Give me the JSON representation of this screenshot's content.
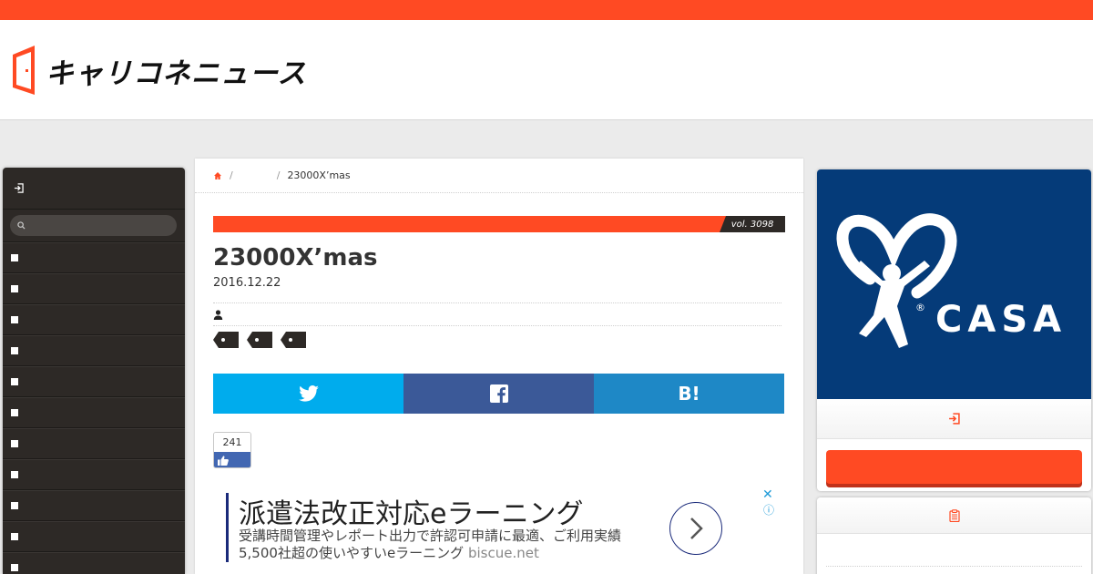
{
  "brand": {
    "logo_text": "キャリコネニュース",
    "accent_color": "#ff4a23"
  },
  "leftnav": {
    "login_icon": "login-icon",
    "search_icon": "search-icon",
    "search_placeholder": "",
    "item_count": 11
  },
  "breadcrumb": {
    "home_icon": "home-icon",
    "separator": "/",
    "current": "23000X’mas"
  },
  "article": {
    "vol": "vol. 3098",
    "title": "23000X’mas",
    "date": "2016.12.22",
    "author_icon": "user-icon",
    "tag_icons": [
      "tag-icon",
      "tag-icon",
      "tag-icon"
    ]
  },
  "share": {
    "twitter_icon": "twitter-icon",
    "facebook_icon": "facebook-icon",
    "hatena_label": "B!"
  },
  "like": {
    "count": "241",
    "icon": "thumbs-up-icon"
  },
  "ad": {
    "headline": "派遣法改正対応eラーニング",
    "line1": "受講時間管理やレポート出力で許認可申請に最適、ご利用実績",
    "line2": "5,500社超の使いやすいeラーニング",
    "domain": "biscue.net",
    "close": "✕",
    "info": "ⓘ"
  },
  "sidebar": {
    "banner_text": "CASA",
    "banner_registered": "®",
    "login_icon": "login-icon",
    "clipboard_icon": "clipboard-icon"
  },
  "colors": {
    "twitter": "#00aced",
    "facebook": "#3b5998",
    "hatena": "#1e88c6",
    "nav_bg": "#2d2926",
    "banner_bg": "#053b79"
  }
}
